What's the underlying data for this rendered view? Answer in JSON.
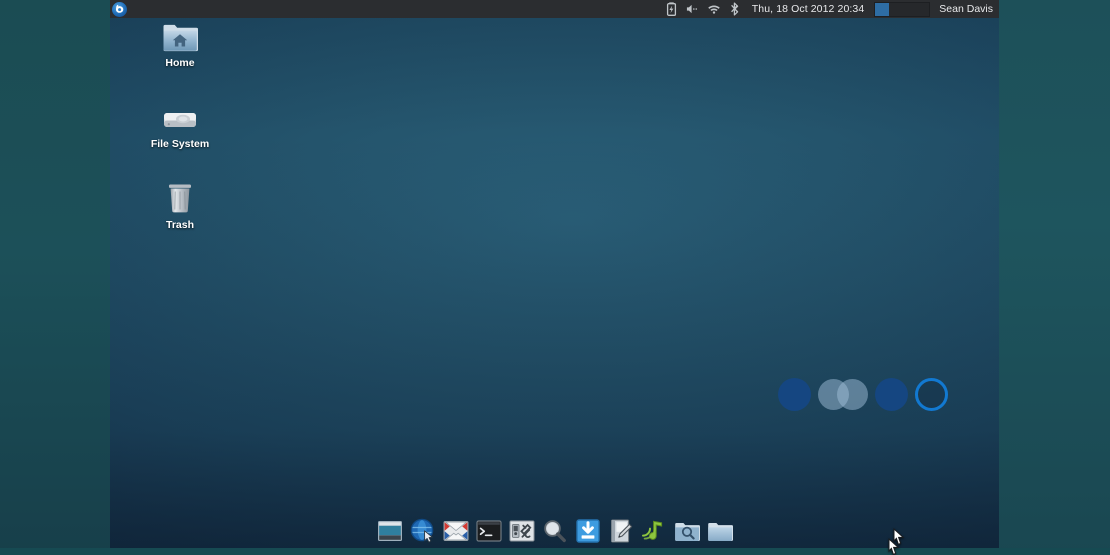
{
  "desktop": {
    "environment": "Xfce Desktop",
    "wallpaper_color": "#24546c",
    "icons": [
      {
        "label": "Home",
        "icon": "home-folder-icon"
      },
      {
        "label": "File System",
        "icon": "hard-drive-icon"
      },
      {
        "label": "Trash",
        "icon": "trash-can-icon"
      }
    ]
  },
  "panel": {
    "menu": {
      "icon": "xfce-mouse-logo-icon",
      "label": "Applications"
    },
    "tray": [
      {
        "name": "battery-icon",
        "label": "Battery"
      },
      {
        "name": "volume-icon",
        "label": "Volume"
      },
      {
        "name": "wifi-icon",
        "label": "Wireless Network"
      },
      {
        "name": "bluetooth-icon",
        "label": "Bluetooth"
      }
    ],
    "clock": "Thu, 18 Oct 2012 20:34",
    "workspaces": [
      {
        "name": "workspace-1",
        "active": true
      },
      {
        "name": "workspace-2",
        "active": false
      },
      {
        "name": "workspace-3",
        "active": false
      },
      {
        "name": "workspace-4",
        "active": false
      }
    ],
    "workspace_active_color": "#2e6da4",
    "user": "Sean Davis"
  },
  "circles_widget": [
    {
      "name": "circle-filled-1",
      "style": "filled",
      "color": "#154681"
    },
    {
      "name": "circle-pair",
      "style": "overlapping-pair",
      "color": "#a0bed7"
    },
    {
      "name": "circle-filled-2",
      "style": "filled",
      "color": "#154681"
    },
    {
      "name": "circle-ring",
      "style": "ring",
      "color": "#1279d1"
    }
  ],
  "dock": {
    "items": [
      {
        "name": "show-desktop-icon",
        "label": "Show Desktop"
      },
      {
        "name": "web-browser-icon",
        "label": "Web Browser"
      },
      {
        "name": "mail-client-icon",
        "label": "Mail Reader"
      },
      {
        "name": "terminal-icon",
        "label": "Terminal Emulator"
      },
      {
        "name": "settings-manager-icon",
        "label": "Settings Manager"
      },
      {
        "name": "search-magnifier-icon",
        "label": "Application Finder"
      },
      {
        "name": "download-icon",
        "label": "Downloads"
      },
      {
        "name": "text-editor-icon",
        "label": "Text Editor"
      },
      {
        "name": "music-player-icon",
        "label": "Music Player"
      },
      {
        "name": "file-search-icon",
        "label": "Search Files"
      },
      {
        "name": "file-manager-icon",
        "label": "File Manager"
      }
    ]
  }
}
